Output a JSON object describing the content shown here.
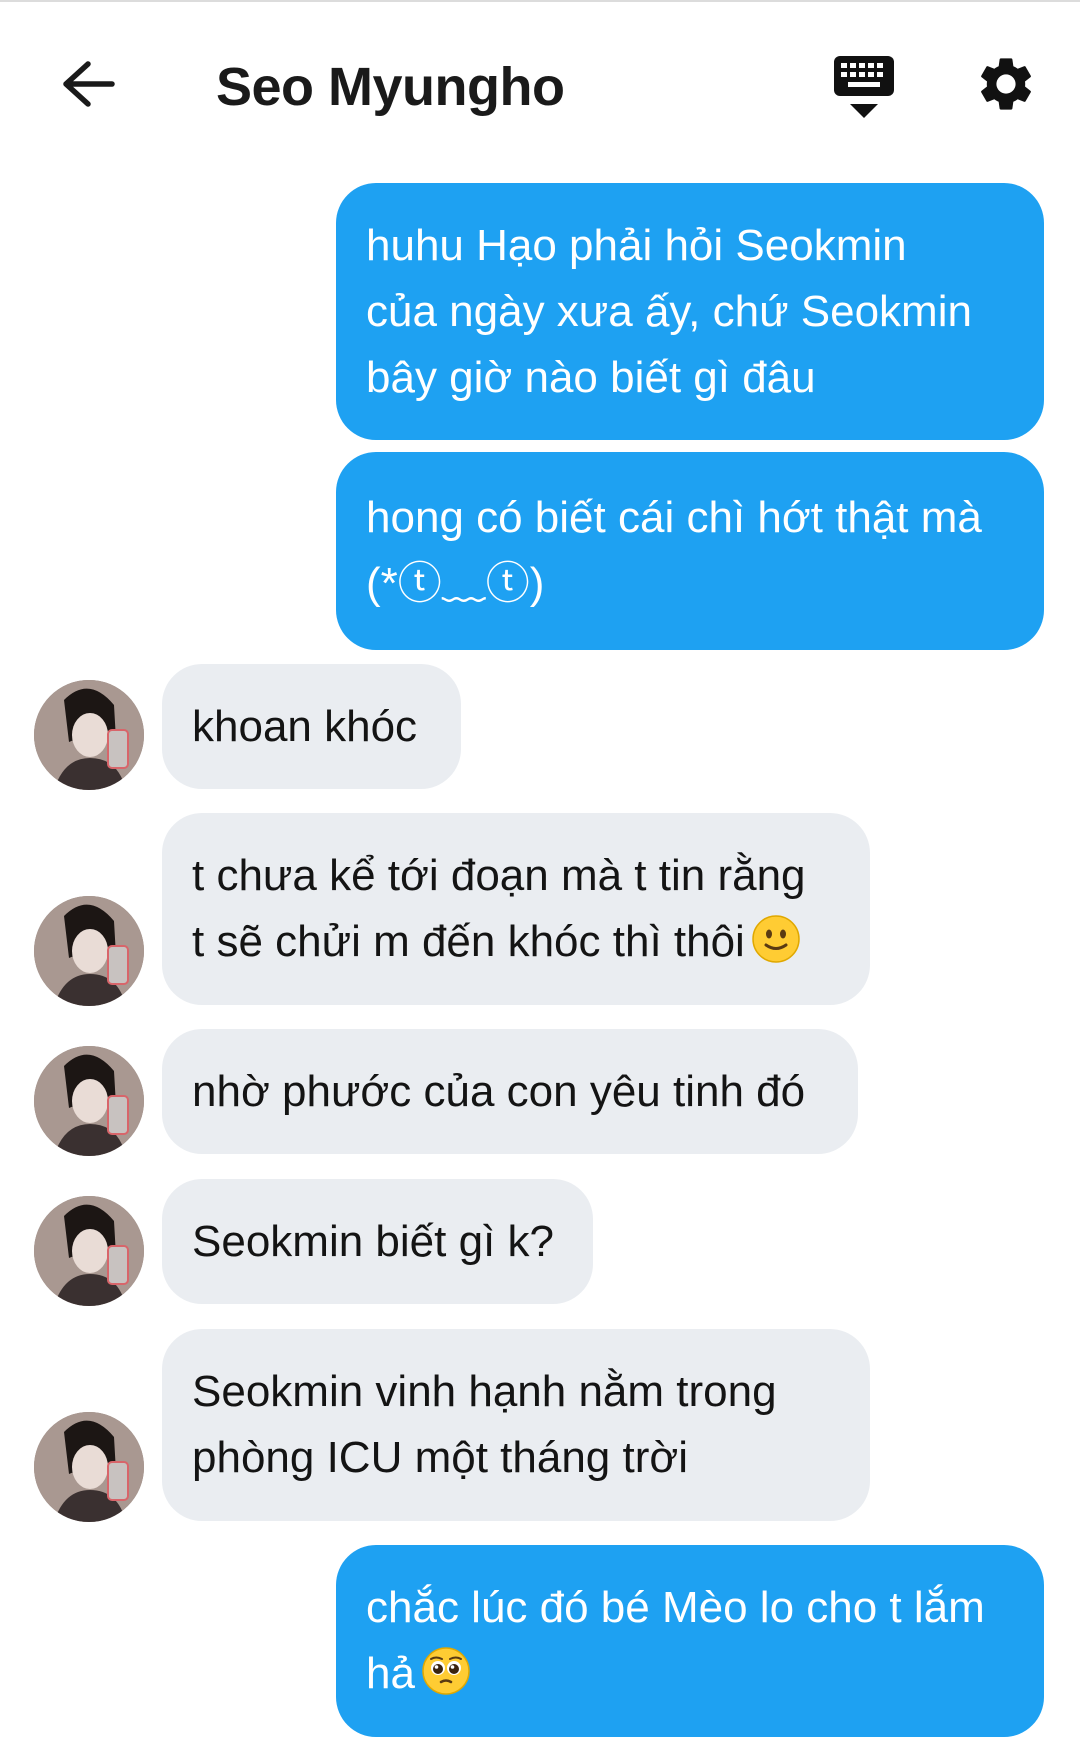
{
  "header": {
    "title": "Seo Myungho",
    "back_icon": "arrow-left-icon",
    "keyboard_icon": "keyboard-icon",
    "settings_icon": "gear-icon"
  },
  "colors": {
    "outgoing_bubble": "#1ea1f2",
    "incoming_bubble": "#eaedf1",
    "text_dark": "#141414"
  },
  "messages": [
    {
      "direction": "outgoing",
      "text": "huhu Hạo phải hỏi Seokmin\ncủa ngày xưa ấy, chứ Seokmin\nbây giờ nào biết gì đâu"
    },
    {
      "direction": "outgoing",
      "text": "hong có biết cái chì hớt thật mà\n(*ⓣ﹏ⓣ)"
    },
    {
      "direction": "incoming",
      "text": "khoan khóc"
    },
    {
      "direction": "incoming",
      "text": "t chưa kể tới đoạn mà t tin rằng\nt sẽ chửi m đến khóc thì thôi",
      "emoji": "slightly-smiling-face-icon"
    },
    {
      "direction": "incoming",
      "text": "nhờ phước của con yêu tinh đó"
    },
    {
      "direction": "incoming",
      "text": "Seokmin biết gì k?"
    },
    {
      "direction": "incoming",
      "text": "Seokmin vinh hạnh nằm trong\nphòng ICU một tháng trời"
    },
    {
      "direction": "outgoing",
      "text": "chắc lúc đó bé Mèo lo cho t lắm\nhả",
      "emoji": "pleading-face-icon"
    }
  ]
}
